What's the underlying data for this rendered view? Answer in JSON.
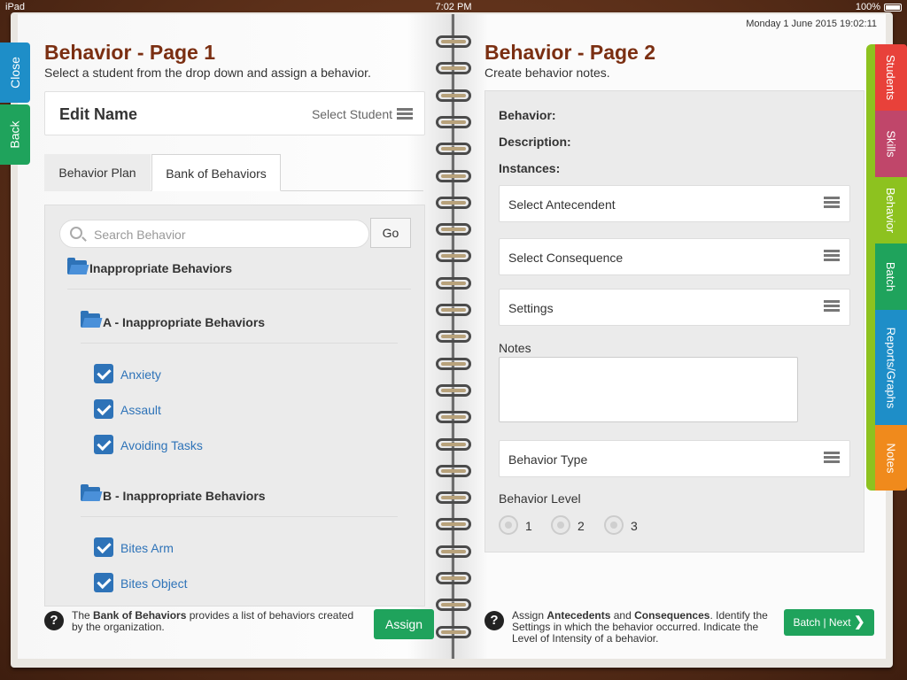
{
  "status_bar": {
    "carrier": "iPad",
    "time": "7:02 PM",
    "battery": "100%"
  },
  "header": {
    "date_time": "Monday 1 June 2015   19:02:11"
  },
  "left_nav": {
    "close": "Close",
    "back": "Back"
  },
  "page1": {
    "title": "Behavior - Page 1",
    "subtitle": "Select a student from the drop down and assign a behavior.",
    "edit_name": "Edit Name",
    "select_student": "Select Student",
    "tabs": [
      "Behavior Plan",
      "Bank of Behaviors"
    ],
    "active_tab": "Bank of Behaviors",
    "search": {
      "placeholder": "Search Behavior",
      "value": "",
      "go": "Go"
    },
    "tree": {
      "root": "Inappropriate Behaviors",
      "groups": [
        {
          "name": "A - Inappropriate Behaviors",
          "items": [
            "Anxiety",
            "Assault",
            "Avoiding Tasks"
          ]
        },
        {
          "name": "B - Inappropriate Behaviors",
          "items": [
            "Bites Arm",
            "Bites Object"
          ]
        }
      ]
    },
    "footer": {
      "prefix": "The ",
      "bold": "Bank of Behaviors",
      "suffix": " provides a list of behaviors created by the organization.",
      "assign": "Assign"
    }
  },
  "page2": {
    "title": "Behavior - Page 2",
    "subtitle": "Create behavior notes.",
    "labels": {
      "behavior": "Behavior:",
      "description": "Description:",
      "instances": "Instances:"
    },
    "selects": {
      "antecedent": "Select Antecendent",
      "consequence": "Select Consequence",
      "settings": "Settings",
      "behavior_type": "Behavior Type"
    },
    "notes_label": "Notes",
    "notes_value": "",
    "level_label": "Behavior Level",
    "levels": [
      "1",
      "2",
      "3"
    ],
    "footer": {
      "t1": "Assign ",
      "b1": "Antecedents",
      "t2": " and ",
      "b2": "Consequences",
      "t3": ". Identify the Settings in which the behavior occurred. Indicate the Level of Intensity of a behavior.",
      "next": "Batch | Next"
    }
  },
  "right_tabs": [
    {
      "label": "Students",
      "color": "#e8413a"
    },
    {
      "label": "Skills",
      "color": "#c0466a"
    },
    {
      "label": "Behavior",
      "color": "#8dc21f"
    },
    {
      "label": "Batch",
      "color": "#1fa35c"
    },
    {
      "label": "Reports/Graphs",
      "color": "#1e8ec8"
    },
    {
      "label": "Notes",
      "color": "#f08a1c"
    }
  ],
  "colors": {
    "title": "#7b2f12",
    "accent_blue": "#2e73b8",
    "green": "#1fa35c",
    "close_tab": "#1e8ec8",
    "back_tab": "#1fa35c"
  }
}
